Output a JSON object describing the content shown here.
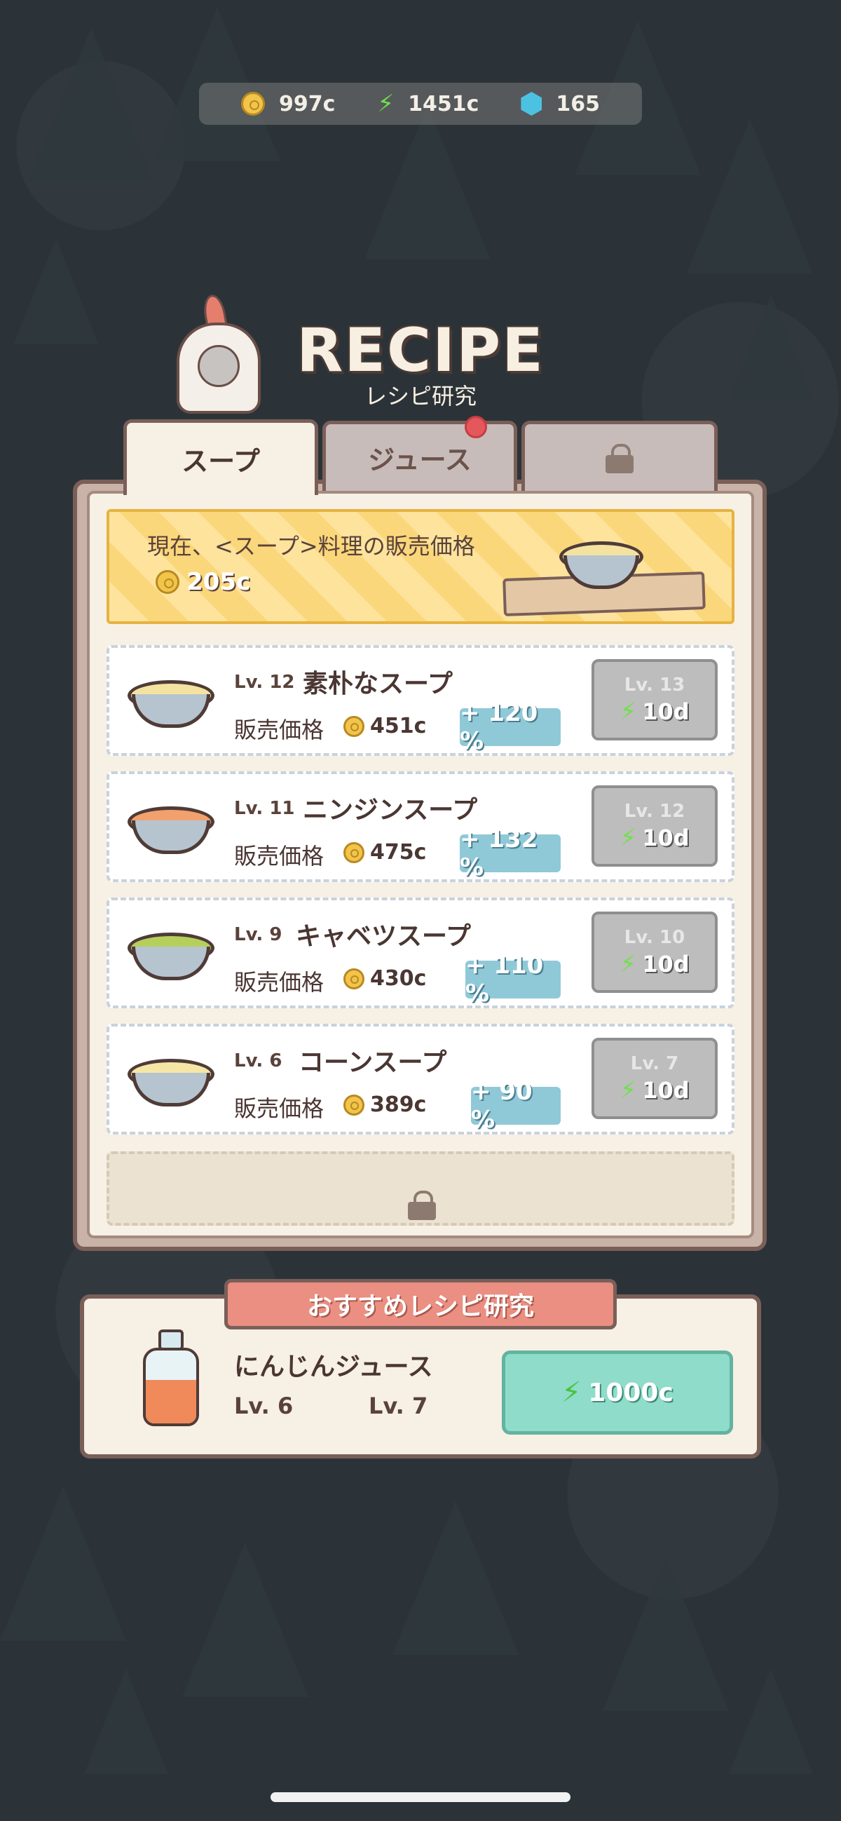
{
  "resources": {
    "coins": "997c",
    "energy": "1451c",
    "gems": "165"
  },
  "title": {
    "main": "RECIPE",
    "sub": "レシピ研究"
  },
  "tabs": [
    {
      "label": "スープ",
      "active": true
    },
    {
      "label": "ジュース",
      "active": false,
      "badge": true
    },
    {
      "label": "",
      "locked": true
    }
  ],
  "banner": {
    "label": "現在、<スープ>料理の販売価格",
    "price": "205c"
  },
  "recipes": [
    {
      "level": "Lv. 12",
      "name": "素朴なスープ",
      "price_label": "販売価格",
      "price": "451c",
      "bonus": "+ 120 %",
      "next_level": "Lv. 13",
      "cost": "10d"
    },
    {
      "level": "Lv. 11",
      "name": "ニンジンスープ",
      "price_label": "販売価格",
      "price": "475c",
      "bonus": "+ 132 %",
      "next_level": "Lv. 12",
      "cost": "10d"
    },
    {
      "level": "Lv. 9",
      "name": "キャベツスープ",
      "price_label": "販売価格",
      "price": "430c",
      "bonus": "+ 110 %",
      "next_level": "Lv. 10",
      "cost": "10d"
    },
    {
      "level": "Lv. 6",
      "name": "コーンスープ",
      "price_label": "販売価格",
      "price": "389c",
      "bonus": "+ 90 %",
      "next_level": "Lv. 7",
      "cost": "10d"
    }
  ],
  "recommended": {
    "header": "おすすめレシピ研究",
    "name": "にんじんジュース",
    "level_from": "Lv. 6",
    "level_to": "Lv. 7",
    "cost": "1000c"
  },
  "colors": {
    "background": "#2b3338",
    "panel": "#f7f0e4",
    "banner": "#fde39c",
    "bonus": "#8fc9d8",
    "upgrade_disabled": "#bdbdbd",
    "recommend_button": "#8fdcca",
    "recommend_header": "#ea8f82"
  },
  "icons": {
    "coin": "coin-icon",
    "energy": "lightning-icon",
    "gem": "gem-icon",
    "lock": "lock-icon"
  }
}
